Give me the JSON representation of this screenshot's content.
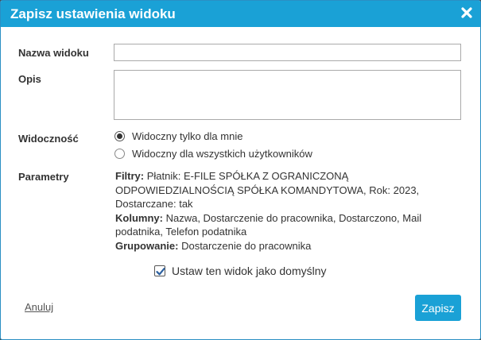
{
  "dialog": {
    "title": "Zapisz ustawienia widoku",
    "close_icon": "close-icon",
    "accent_color": "#1aa1d6"
  },
  "form": {
    "name_label": "Nazwa widoku",
    "name_value": "",
    "description_label": "Opis",
    "description_value": "",
    "visibility_label": "Widoczność",
    "visibility_options": [
      {
        "label": "Widoczny tylko dla mnie",
        "selected": true
      },
      {
        "label": "Widoczny dla wszystkich użytkowników",
        "selected": false
      }
    ],
    "parameters_label": "Parametry",
    "filters_key": "Filtry:",
    "filters_value": "Płatnik: E-FILE SPÓŁKA Z OGRANICZONĄ ODPOWIEDZIALNOŚCIĄ SPÓŁKA KOMANDYTOWA, Rok: 2023, Dostarczane: tak",
    "columns_key": "Kolumny:",
    "columns_value": "Nazwa, Dostarczenie do pracownika, Dostarczono, Mail podatnika, Telefon podatnika",
    "grouping_key": "Grupowanie:",
    "grouping_value": "Dostarczenie do pracownika",
    "default_checkbox_label": "Ustaw ten widok jako domyślny",
    "default_checked": true
  },
  "actions": {
    "cancel_label": "Anuluj",
    "save_label": "Zapisz"
  }
}
